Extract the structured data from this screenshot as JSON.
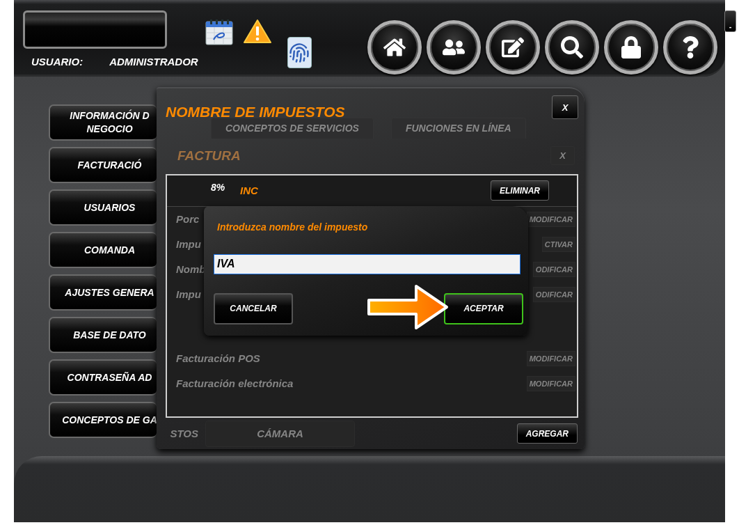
{
  "header": {
    "user_label": "USUARIO:",
    "user_name": "ADMINISTRADOR",
    "minimize": "-"
  },
  "sidebar": {
    "items": [
      {
        "lines": [
          "INFORMACIÓN D",
          "NEGOCIO"
        ]
      },
      {
        "lines": [
          "FACTURACIÓ"
        ]
      },
      {
        "lines": [
          "USUARIOS"
        ]
      },
      {
        "lines": [
          "COMANDA"
        ]
      },
      {
        "lines": [
          "AJUSTES GENERA"
        ]
      },
      {
        "lines": [
          "BASE DE DATO"
        ]
      },
      {
        "lines": [
          "CONTRASEÑA AD"
        ]
      },
      {
        "lines": [
          "CONCEPTOS DE GA"
        ]
      }
    ]
  },
  "taxes_dialog": {
    "title": "NOMBRE DE IMPUESTOS",
    "close": "X",
    "background_tabs": [
      "CONCEPTOS DE SERVICIOS",
      "FUNCIONES EN LÍNEA"
    ],
    "background_section": "FACTURA",
    "background_close": "X",
    "tax_rows": [
      {
        "rate": "8%",
        "name": "INC",
        "action": "ELIMINAR"
      }
    ],
    "background_rows": [
      {
        "label": "Porc",
        "action": "MODIFICAR"
      },
      {
        "label": "Impu",
        "action": "CTIVAR"
      },
      {
        "label": "Nomb",
        "action": "ODIFICAR"
      },
      {
        "label": "Impu",
        "action": "ODIFICAR"
      },
      {
        "label": "Facturación POS",
        "action": "MODIFICAR"
      },
      {
        "label": "Facturación electrónica",
        "action": "MODIFICAR"
      }
    ],
    "background_footer": [
      "STOS",
      "CÁMARA"
    ],
    "add_button": "AGREGAR"
  },
  "name_prompt": {
    "label": "Introduzca nombre del impuesto",
    "value": "IVA",
    "cancel": "CANCELAR",
    "accept": "ACEPTAR"
  }
}
